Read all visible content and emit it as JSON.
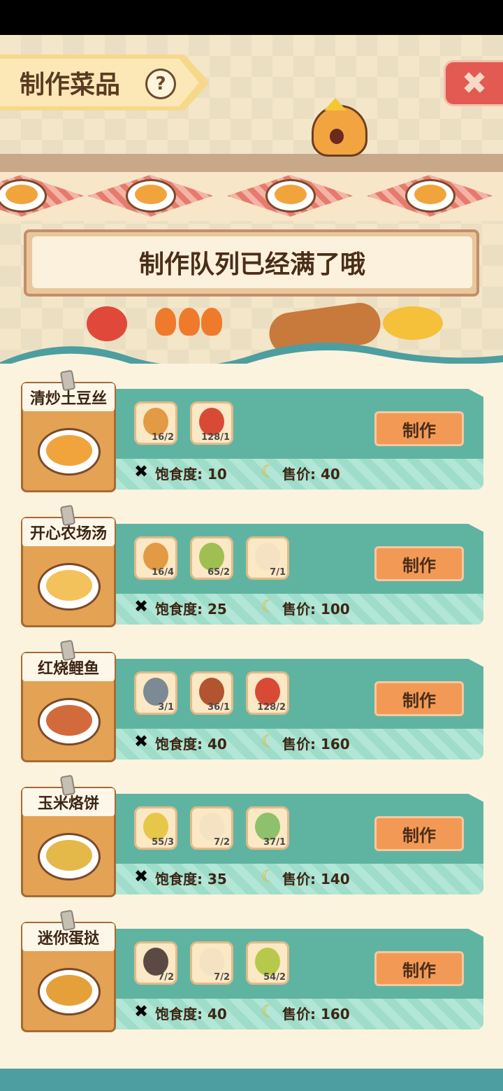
{
  "header": {
    "title": "制作菜品",
    "help_icon": "?",
    "close_icon": "✖"
  },
  "queue_notice": "制作队列已经满了哦",
  "recipes": [
    {
      "name": "清炒土豆丝",
      "food_color": "#f1a43b",
      "ingredients": [
        {
          "icon": "potato-icon",
          "color": "#e29a44",
          "count": "16/2"
        },
        {
          "icon": "chili-icon",
          "color": "#d94a36",
          "count": "128/1"
        }
      ],
      "satiety": "饱食度: 10",
      "price": "售价: 40",
      "button": "制作"
    },
    {
      "name": "开心农场汤",
      "food_color": "#f4c25a",
      "ingredients": [
        {
          "icon": "potato-icon",
          "color": "#e29a44",
          "count": "16/4"
        },
        {
          "icon": "cabbage-icon",
          "color": "#9fbf52",
          "count": "65/2"
        },
        {
          "icon": "egg-icon",
          "color": "#f4e2c2",
          "count": "7/1"
        }
      ],
      "satiety": "饱食度: 25",
      "price": "售价: 100",
      "button": "制作"
    },
    {
      "name": "红烧鲤鱼",
      "food_color": "#d36a3c",
      "ingredients": [
        {
          "icon": "fish-icon",
          "color": "#7b8a93",
          "count": "3/1"
        },
        {
          "icon": "sauce-icon",
          "color": "#b1542f",
          "count": "36/1"
        },
        {
          "icon": "chili-icon",
          "color": "#d94a36",
          "count": "128/2"
        }
      ],
      "satiety": "饱食度: 40",
      "price": "售价: 160",
      "button": "制作"
    },
    {
      "name": "玉米烙饼",
      "food_color": "#e5b84a",
      "ingredients": [
        {
          "icon": "corn-icon",
          "color": "#e7c74a",
          "count": "55/3"
        },
        {
          "icon": "egg-icon",
          "color": "#f4e2c2",
          "count": "7/2"
        },
        {
          "icon": "scallion-icon",
          "color": "#8fc06b",
          "count": "37/1"
        }
      ],
      "satiety": "饱食度: 35",
      "price": "售价: 140",
      "button": "制作"
    },
    {
      "name": "迷你蛋挞",
      "food_color": "#e6a03a",
      "ingredients": [
        {
          "icon": "milk-icon",
          "color": "#5b4a44",
          "count": "7/2"
        },
        {
          "icon": "egg-icon",
          "color": "#f4e2c2",
          "count": "7/2"
        },
        {
          "icon": "wheat-icon",
          "color": "#b7c94a",
          "count": "54/2"
        }
      ],
      "satiety": "饱食度: 40",
      "price": "售价: 160",
      "button": "制作"
    }
  ]
}
